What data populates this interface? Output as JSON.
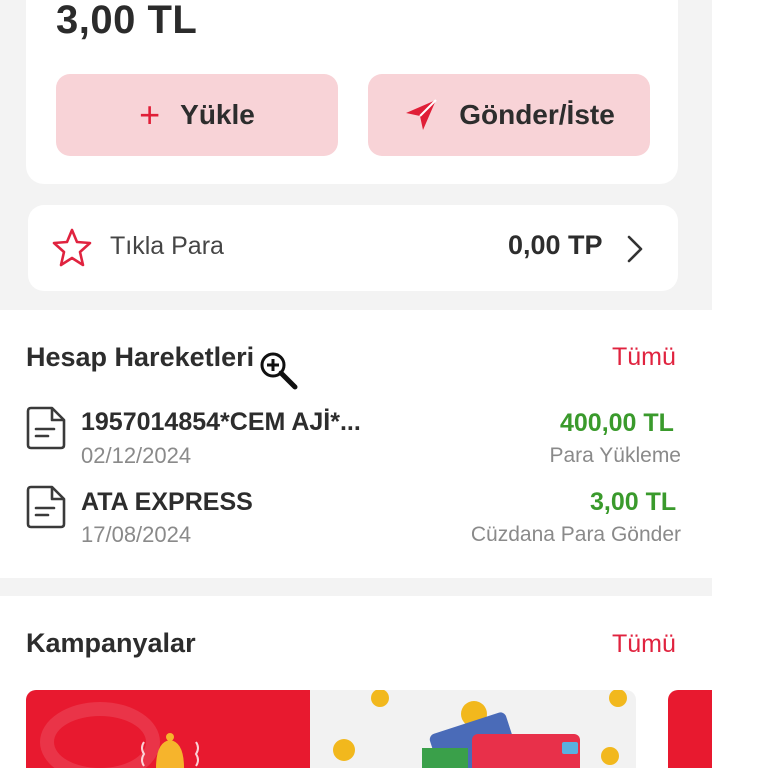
{
  "wallet": {
    "balance": "3,00 TL",
    "load_label": "Yükle",
    "send_label": "Gönder/İste"
  },
  "tikla_para": {
    "label": "Tıkla Para",
    "value": "0,00 TP"
  },
  "transactions": {
    "title": "Hesap Hareketleri",
    "see_all": "Tümü",
    "items": [
      {
        "title": "1957014854*CEM AJİ*...",
        "date": "02/12/2024",
        "amount": "400,00 TL",
        "type": "Para Yükleme"
      },
      {
        "title": "ATA EXPRESS",
        "date": "17/08/2024",
        "amount": "3,00 TL",
        "type": "Cüzdana Para Gönder"
      }
    ]
  },
  "campaigns": {
    "title": "Kampanyalar",
    "see_all": "Tümü"
  },
  "colors": {
    "accent": "#e0233f",
    "button_bg": "#f8d3d7",
    "positive_amount": "#3a9a2c",
    "page_bg": "#f3f3f3"
  },
  "icons": {
    "load": "plus-icon",
    "send": "send-arrow-icon",
    "tikla_para": "star-icon",
    "transaction": "document-icon",
    "chevron": "chevron-right-icon",
    "cursor": "zoom-in-cursor-icon"
  }
}
